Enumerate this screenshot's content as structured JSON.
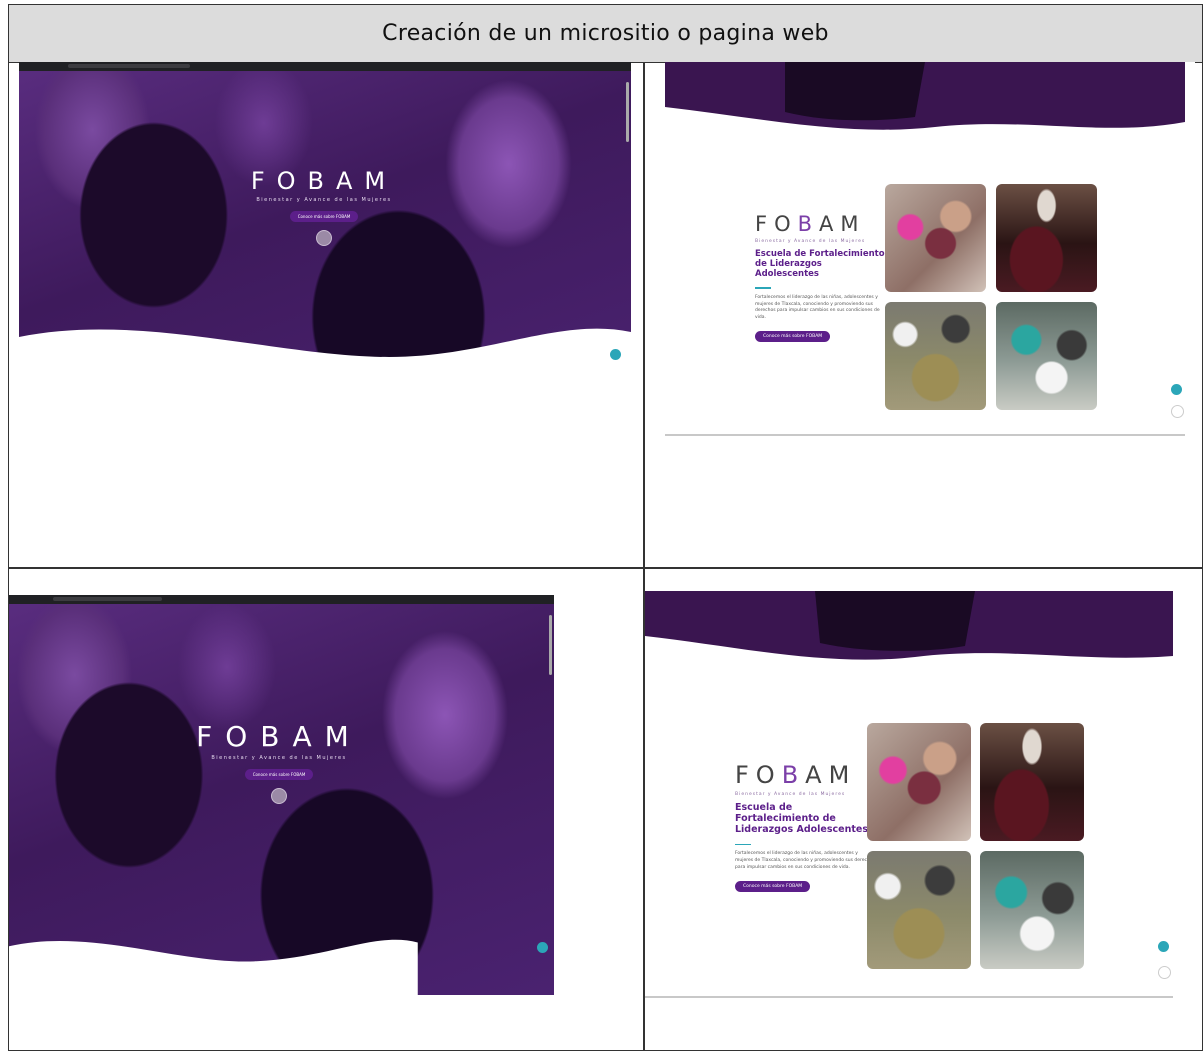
{
  "document": {
    "header_title": "Creación de un micrositio o pagina web"
  },
  "screens": {
    "hero": {
      "logo": "FOBAM",
      "tagline": "Bienestar y Avance de las Mujeres",
      "button_label": "Conoce más sobre FOBAM"
    },
    "section": {
      "logo_parts": [
        "FO",
        "B",
        "AM"
      ],
      "tagline": "Bienestar y Avance de las Mujeres",
      "heading": "Escuela de Fortalecimiento de Liderazgos Adolescentes",
      "paragraph": "Fortalecemos el liderazgo de las niñas, adolescentes y mujeres de Tlaxcala, conociendo y promoviendo sus derechos para impulsar cambios en sus condiciones de vida.",
      "cta_label": "Conoce más sobre FOBAM"
    }
  },
  "colors": {
    "brand_purple": "#5c1f8a",
    "accent_teal": "#2ba6b8",
    "header_gray": "#dcdcdc"
  }
}
